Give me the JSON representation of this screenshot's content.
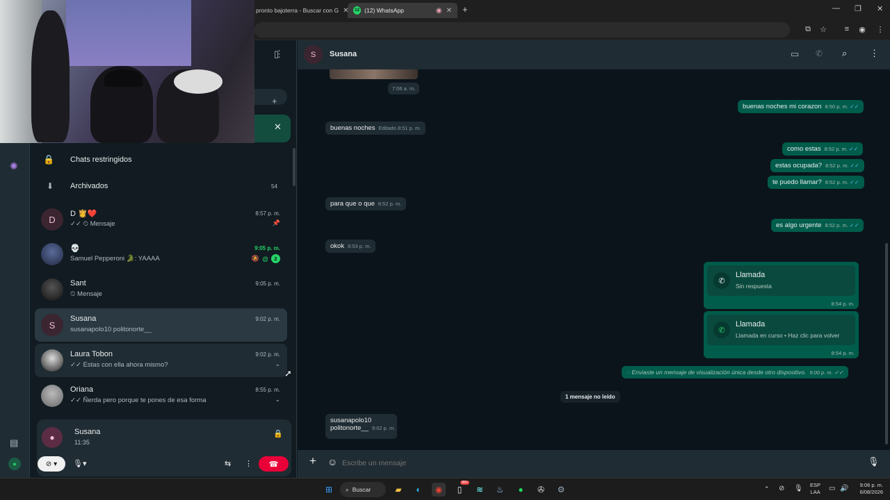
{
  "browser": {
    "tabs": [
      {
        "title": "pronto bajoterra - Buscar con G",
        "active": false
      },
      {
        "title": "(12) WhatsApp",
        "badge": "12",
        "active": true
      }
    ],
    "new_tab": "+"
  },
  "sidebar": {
    "restricted": "Chats restringidos",
    "archived": "Archivados",
    "archived_count": "54",
    "chats": [
      {
        "avatar": "D",
        "name": "D 👸❤️",
        "msg": "✓✓ ⏲ Mensaje",
        "time": "8:57 p. m."
      },
      {
        "avatar": "",
        "name": "💀",
        "msg": "Samuel Pepperoni 🐊: YAAAA",
        "time": "9:05 p. m.",
        "unread": "2"
      },
      {
        "avatar": "",
        "name": "Sant",
        "msg": "⏲ Mensaje",
        "time": "9:05 p. m."
      },
      {
        "avatar": "S",
        "name": "Susana",
        "msg": "susanapolo10 politonorte__",
        "time": "9:02 p. m."
      },
      {
        "avatar": "",
        "name": "Laura Tobon",
        "msg": "✓✓ Estas con ella ahora mismo?",
        "time": "9:02 p. m."
      },
      {
        "avatar": "",
        "name": "Oriana",
        "msg": "✓✓ Ñerda pero porque te pones de esa forma",
        "time": "8:55 p. m."
      }
    ]
  },
  "call": {
    "name": "Susana",
    "duration": "11:35"
  },
  "conversation": {
    "contact": "Susana",
    "avatar": "S",
    "messages": [
      {
        "dir": "in",
        "text": "",
        "time": "7:06 a. m."
      },
      {
        "dir": "out",
        "text": "buenas noches mi corazon",
        "time": "8:50 p. m."
      },
      {
        "dir": "in",
        "text": "buenas noches",
        "time": "Editado 8:51 p. m."
      },
      {
        "dir": "out",
        "text": "como estas",
        "time": "8:52 p. m."
      },
      {
        "dir": "out",
        "text": "estas ocupada?",
        "time": "8:52 p. m."
      },
      {
        "dir": "out",
        "text": "te puedo llamar?",
        "time": "8:52 p. m."
      },
      {
        "dir": "in",
        "text": "para que o que",
        "time": "8:52 p. m."
      },
      {
        "dir": "out",
        "text": "es algo urgente",
        "time": "8:52 p. m."
      },
      {
        "dir": "in",
        "text": "okok",
        "time": "8:53 p. m."
      }
    ],
    "calls": [
      {
        "title": "Llamada",
        "sub": "Sin respuesta",
        "time": "8:54 p. m."
      },
      {
        "title": "Llamada",
        "sub": "Llamada en curso • Haz clic para volver",
        "time": "8:54 p. m."
      }
    ],
    "view_once": {
      "text": "Enviaste un mensaje de visualización única desde otro dispositivo.",
      "time": "9:00 p. m."
    },
    "unread_divider": "1 mensaje no leído",
    "last": {
      "line1": "susanapolo10",
      "line2": "politonorte__",
      "time": "9:02 p. m."
    },
    "composer_placeholder": "Escribe un mensaje"
  },
  "taskbar": {
    "search": "Buscar",
    "lang1": "ESP",
    "lang2": "LAA",
    "time": "9:06 p. m.",
    "date": "6/08/2026",
    "badge": "99+"
  },
  "colors": {
    "outgoing": "#005c4b",
    "incoming": "#202c33",
    "accent": "#25d366",
    "end_call": "#ea0038"
  }
}
